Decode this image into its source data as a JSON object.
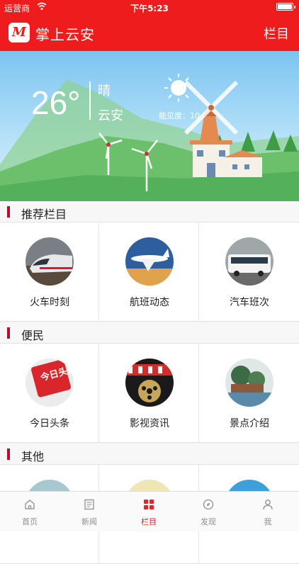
{
  "status_bar": {
    "carrier": "运营商",
    "time": "下午5:23"
  },
  "nav": {
    "title": "掌上云安",
    "right_label": "栏目"
  },
  "weather": {
    "temperature": "26°",
    "condition": "晴",
    "city": "云安",
    "visibility_label": "能见度：",
    "visibility_value": "10"
  },
  "sections": [
    {
      "title": "推荐栏目",
      "items": [
        {
          "label": "火车时刻",
          "icon": "train-icon"
        },
        {
          "label": "航班动态",
          "icon": "airplane-icon"
        },
        {
          "label": "汽车班次",
          "icon": "bus-icon"
        }
      ]
    },
    {
      "title": "便民",
      "items": [
        {
          "label": "今日头条",
          "icon": "toutiao-icon",
          "badge_text": "今日头条"
        },
        {
          "label": "影视资讯",
          "icon": "film-icon"
        },
        {
          "label": "景点介绍",
          "icon": "scenery-icon"
        }
      ]
    },
    {
      "title": "其他",
      "items": []
    }
  ],
  "tabs": [
    {
      "label": "首页",
      "icon": "home-icon"
    },
    {
      "label": "新闻",
      "icon": "news-icon"
    },
    {
      "label": "栏目",
      "icon": "grid-icon",
      "active": true
    },
    {
      "label": "发现",
      "icon": "compass-icon"
    },
    {
      "label": "我",
      "icon": "person-icon"
    }
  ],
  "colors": {
    "brand": "#ee1c1c",
    "accent_bar": "#b2102f",
    "tab_active": "#e8242a"
  }
}
